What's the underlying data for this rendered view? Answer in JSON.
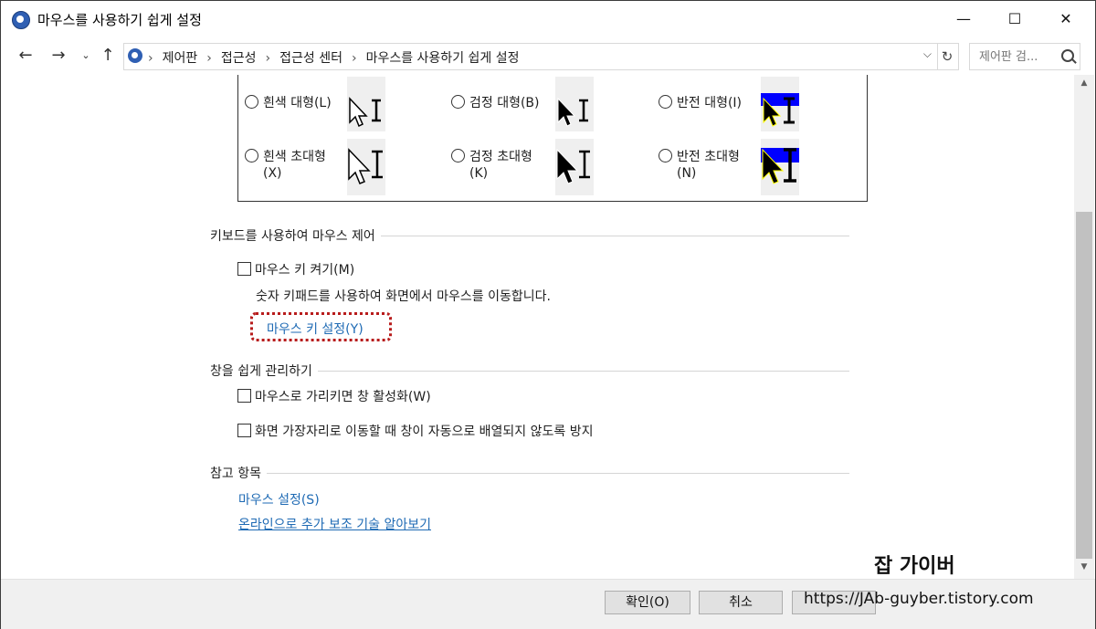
{
  "window": {
    "title": "마우스를 사용하기 쉽게 설정",
    "minimize": "—",
    "maximize": "☐",
    "close": "✕"
  },
  "nav": {
    "back_icon": "arrow-left-icon",
    "forward_icon": "arrow-right-icon",
    "recent_icon": "chevron-down-icon",
    "up_icon": "arrow-up-icon",
    "breadcrumbs": [
      "제어판",
      "접근성",
      "접근성 센터",
      "마우스를 사용하기 쉽게 설정"
    ],
    "search_placeholder": "제어판 검..."
  },
  "pointers": {
    "options": [
      {
        "label": "흰색 대형(L)",
        "style": "white-large"
      },
      {
        "label": "검정 대형(B)",
        "style": "black-large"
      },
      {
        "label": "반전 대형(I)",
        "style": "inverted-large"
      },
      {
        "label": "흰색 초대형",
        "sub": "(X)",
        "style": "white-xl"
      },
      {
        "label": "검정 초대형",
        "sub": "(K)",
        "style": "black-xl"
      },
      {
        "label": "반전 초대형",
        "sub": "(N)",
        "style": "inverted-xl"
      }
    ]
  },
  "keyboard_section": {
    "heading": "키보드를 사용하여 마우스 제어",
    "mouse_keys_label": "마우스 키 켜기(M)",
    "mouse_keys_checked": false,
    "description": "숫자 키패드를 사용하여 화면에서 마우스를 이동합니다.",
    "settings_link": "마우스 키 설정(Y)"
  },
  "window_section": {
    "heading": "창을 쉽게 관리하기",
    "hover_activate_label": "마우스로 가리키면 창 활성화(W)",
    "hover_activate_checked": false,
    "prevent_snap_label": "화면 가장자리로 이동할 때 창이 자동으로 배열되지 않도록 방지",
    "prevent_snap_checked": false
  },
  "see_also": {
    "heading": "참고 항목",
    "links": [
      "마우스 설정(S)",
      "온라인으로 추가 보조 기술 알아보기"
    ]
  },
  "buttons": {
    "ok": "확인(O)",
    "cancel": "취소",
    "apply": "적용(A)"
  },
  "watermark": {
    "name": "잡 가이버",
    "url": "https://JAb-guyber.tistory.com"
  },
  "colors": {
    "link": "#1e6ab4",
    "highlight_border": "#b81c1c",
    "inverted_bg": "#0000ff"
  }
}
